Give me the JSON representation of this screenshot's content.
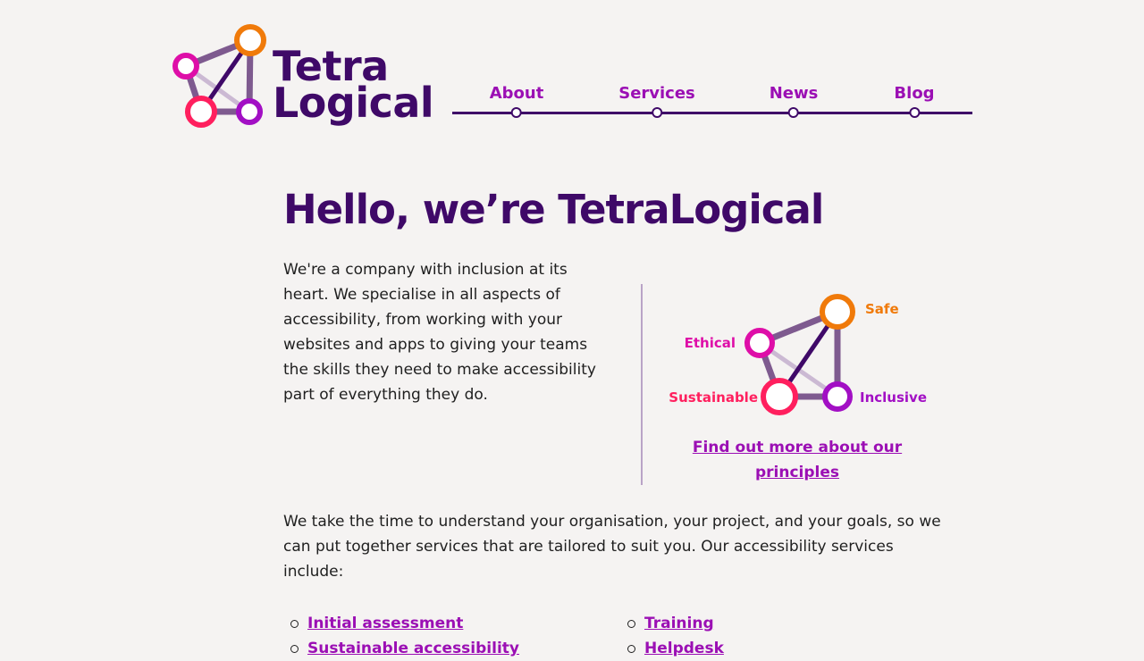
{
  "logo": {
    "line1": "Tetra",
    "line2": "Logical"
  },
  "nav": {
    "items": [
      {
        "label": "About"
      },
      {
        "label": "Services"
      },
      {
        "label": "News"
      },
      {
        "label": "Blog"
      }
    ]
  },
  "main": {
    "title": "Hello, we’re TetraLogical",
    "intro": "We're a company with inclusion at its heart. We specialise in all aspects of accessibility, from working with your websites and apps to giving your teams the skills they need to make accessibility part of everything they do.",
    "principles": {
      "labels": {
        "safe": "Safe",
        "ethical": "Ethical",
        "sustainable": "Sustainable",
        "inclusive": "Inclusive"
      },
      "link": "Find out more about our principles"
    },
    "services_intro": "We take the time to understand your organisation, your project, and your goals, so we can put together services that are tailored to suit you. Our accessibility services include:",
    "services_left": [
      {
        "label": "Initial assessment"
      },
      {
        "label": "Sustainable accessibility"
      }
    ],
    "services_right": [
      {
        "label": "Training"
      },
      {
        "label": "Helpdesk"
      }
    ]
  },
  "colors": {
    "brand_dark": "#3f0968",
    "link": "#9b0fb4",
    "orange": "#f07a0a",
    "magenta": "#de0ea8",
    "pink": "#ff1f5e",
    "purple": "#a20fc4",
    "edge": "#7e5a8f",
    "edge_light": "#cbb9d3"
  }
}
